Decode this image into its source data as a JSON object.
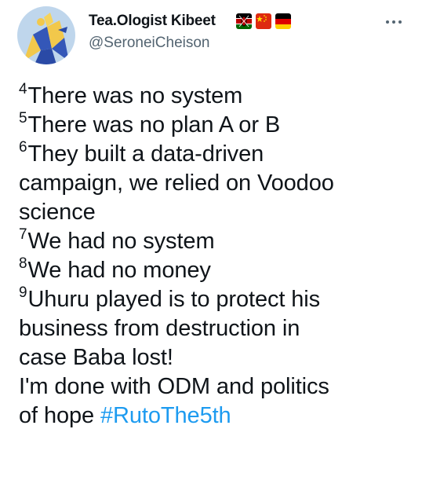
{
  "author": {
    "display_name": "Tea.Ologist Kibeet",
    "handle": "@SeroneiCheison",
    "flags": [
      "kenya-flag-icon",
      "china-flag-icon",
      "germany-flag-icon"
    ]
  },
  "more_icon": "more-horizontal-icon",
  "colors": {
    "text": "#0f1419",
    "secondary": "#536471",
    "link": "#1d9bf0"
  },
  "tweet": {
    "lines": [
      {
        "sup": "4",
        "text": "There was no system"
      },
      {
        "sup": "5",
        "text": "There was no plan A or B"
      },
      {
        "sup": "6",
        "text": "They built a data-driven"
      },
      {
        "sup": "",
        "text": "campaign, we relied on Voodoo"
      },
      {
        "sup": "",
        "text": "science"
      },
      {
        "sup": "7",
        "text": "We had no system"
      },
      {
        "sup": "8",
        "text": "We had no money"
      },
      {
        "sup": "9",
        "text": "Uhuru played is to protect his"
      },
      {
        "sup": "",
        "text": "business from destruction in"
      },
      {
        "sup": "",
        "text": "case Baba lost!"
      },
      {
        "sup": "",
        "text": "I'm done with ODM and politics"
      },
      {
        "sup": "",
        "text": "of hope "
      }
    ],
    "hashtag": "#RutoThe5th"
  }
}
